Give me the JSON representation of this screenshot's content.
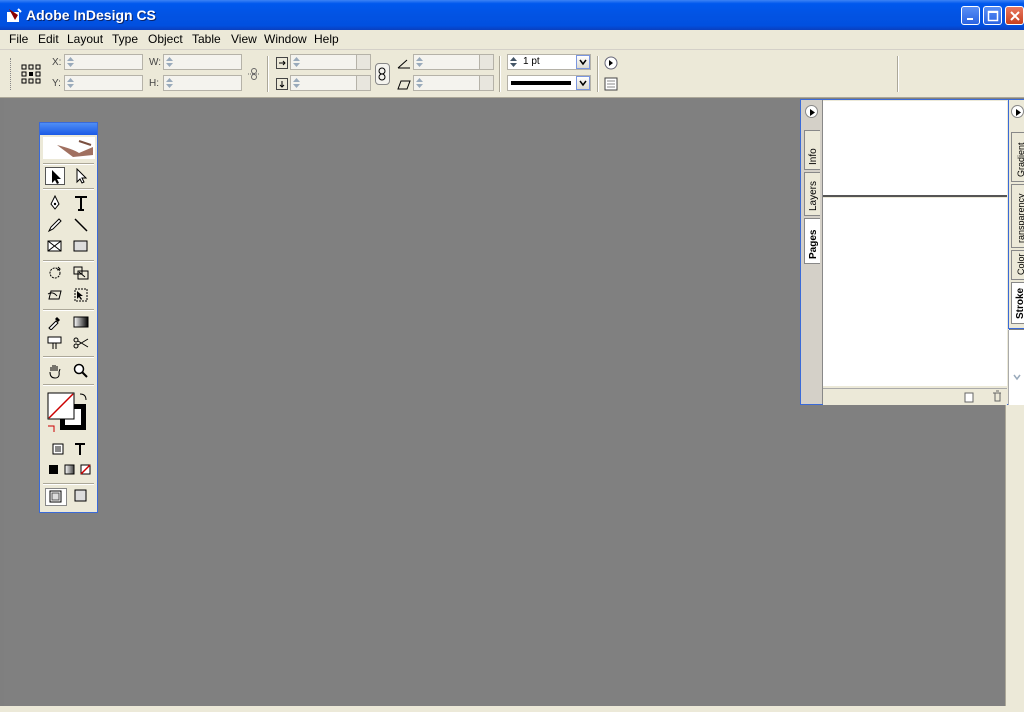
{
  "window": {
    "title": "Adobe InDesign CS",
    "app_icon": "indesign-app-icon",
    "controls": [
      "minimize-icon",
      "maximize-icon",
      "close-icon"
    ]
  },
  "menu": {
    "items": [
      "File",
      "Edit",
      "Layout",
      "Type",
      "Object",
      "Table",
      "View",
      "Window",
      "Help"
    ]
  },
  "control_bar": {
    "x_label": "X:",
    "y_label": "Y:",
    "w_label": "W:",
    "h_label": "H:",
    "stroke_weight": "1 pt",
    "stroke_type": "solid-line"
  },
  "toolbox": {
    "tools": [
      "selection-tool-icon",
      "direct-selection-tool-icon",
      "pen-tool-icon",
      "type-tool-icon",
      "pencil-tool-icon",
      "line-tool-icon",
      "rectangle-frame-tool-icon",
      "rectangle-tool-icon",
      "rotate-tool-icon",
      "scale-tool-icon",
      "shear-tool-icon",
      "free-transform-tool-icon",
      "eyedropper-tool-icon",
      "gradient-tool-icon",
      "button-tool-icon",
      "scissors-tool-icon",
      "hand-tool-icon",
      "zoom-tool-icon"
    ],
    "selected_tool": "selection-tool-icon"
  },
  "pages_panel": {
    "tabs": [
      "Info",
      "Layers",
      "Pages"
    ],
    "active_tab": "Pages"
  },
  "stroke_panel": {
    "tabs": [
      "Gradient",
      "Transparency",
      "Color",
      "Stroke"
    ],
    "visible_labels": [
      "Gradient",
      "ransparency",
      "Color",
      "Stroke"
    ],
    "active_tab": "Stroke"
  },
  "colors": {
    "title_bar": "#0054e3",
    "workspace": "#808080",
    "chrome": "#ece9d8"
  }
}
